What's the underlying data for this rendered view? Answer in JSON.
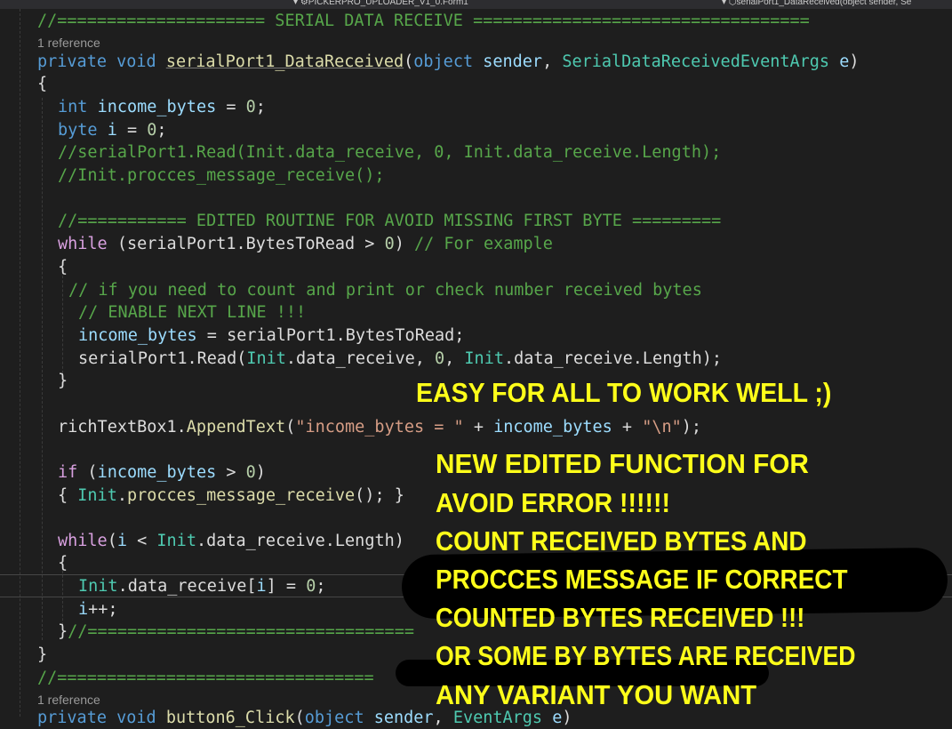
{
  "topbar": {
    "project_dropdown": "PICKERPRO_UPLOADER_V1_0.Form1",
    "member_dropdown": "serialPort1_DataReceived(object sender, Se"
  },
  "editor": {
    "references": [
      "1 reference",
      "1 reference"
    ],
    "lines": [
      "//===================== SERIAL DATA RECEIVE ==================================",
      "private void serialPort1_DataReceived(object sender, SerialDataReceivedEventArgs e)",
      "{",
      "int income_bytes = 0;",
      "byte i = 0;",
      "//serialPort1.Read(Init.data_receive, 0, Init.data_receive.Length);",
      "//Init.procces_message_receive();",
      "//=========== EDITED ROUTINE FOR AVOID MISSING FIRST BYTE =========",
      "while (serialPort1.BytesToRead > 0) // For example",
      "{",
      "// if you need to count and print or check number received bytes",
      "// ENABLE NEXT LINE !!!",
      "income_bytes = serialPort1.BytesToRead;",
      "serialPort1.Read(Init.data_receive, 0, Init.data_receive.Length);",
      "}",
      "richTextBox1.AppendText(\"income_bytes = \" + income_bytes + \"\\n\");",
      "if (income_bytes > 0)",
      "{ Init.procces_message_receive(); }",
      "while(i < Init.data_receive.Length)",
      "{",
      "Init.data_receive[i] = 0;",
      "i++;",
      "}//=================================",
      "}",
      "//================================",
      "private void button6_Click(object sender, EventArgs e)"
    ]
  },
  "annotations": {
    "top": "EASY FOR ALL TO WORK WELL ;)",
    "block": [
      "NEW EDITED FUNCTION FOR",
      "AVOID ERROR !!!!!!",
      "COUNT RECEIVED BYTES AND",
      "PROCCES MESSAGE IF CORRECT",
      "COUNTED BYTES RECEIVED !!!",
      "OR SOME BY BYTES ARE RECEIVED",
      "ANY VARIANT YOU WANT"
    ]
  },
  "colors": {
    "background": "#1e1e1e",
    "keyword": "#569cd6",
    "type": "#4ec9b0",
    "method": "#dcdcaa",
    "parameter": "#9cdcfe",
    "number": "#b5cea8",
    "string": "#d69d85",
    "comment": "#57a64a",
    "annotation": "#ffff1a"
  }
}
